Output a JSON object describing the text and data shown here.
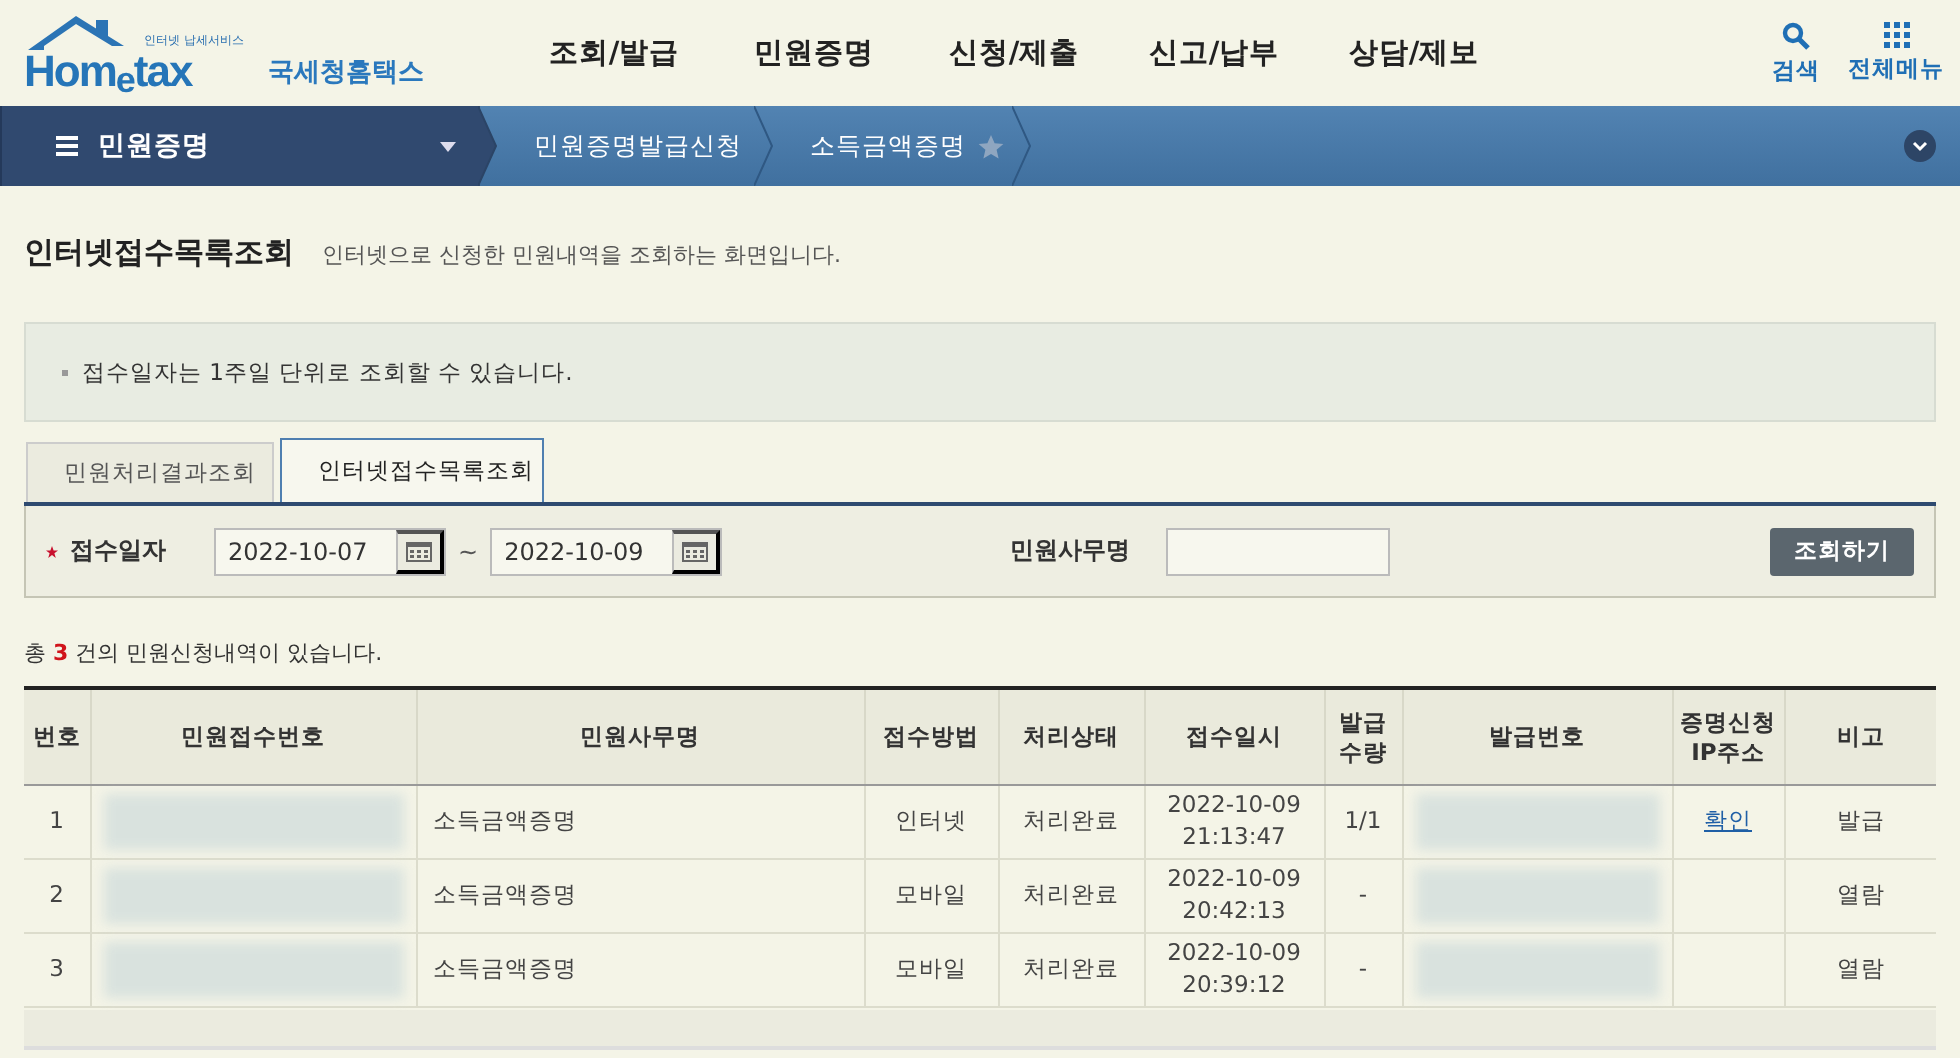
{
  "header": {
    "logo": {
      "tagline": "인터넷 납세서비스",
      "wordmark": "Hom$_{e}$tax",
      "name": "국세청홈택스"
    },
    "menu": [
      "조회/발급",
      "민원증명",
      "신청/제출",
      "신고/납부",
      "상담/제보"
    ],
    "tools": [
      {
        "label": "검색",
        "kind": "search"
      },
      {
        "label": "전체메뉴",
        "kind": "grid"
      }
    ]
  },
  "navbar": {
    "section": "민원증명",
    "breadcrumbs": [
      "민원증명발급신청",
      "소득금액증명"
    ],
    "favorite": false
  },
  "page": {
    "title": "인터넷접수목록조회",
    "description": "인터넷으로 신청한 민원내역을 조회하는 화면입니다.",
    "notices": [
      "접수일자는 1주일 단위로 조회할 수 있습니다."
    ],
    "tabs": [
      {
        "label": "민원처리결과조회",
        "selected": false
      },
      {
        "label": "인터넷접수목록조회",
        "selected": true
      }
    ],
    "search": {
      "date_label": "접수일자",
      "required": true,
      "date_from": "2022-10-07",
      "separator": "~",
      "date_to": "2022-10-09",
      "name_label": "민원사무명",
      "button": "조회하기"
    },
    "count_text": "총 **3** 건의 민원신청내역이 있습니다."
  },
  "table": {
    "columns": [
      "번호",
      "민원접수번호",
      "민원사무명",
      "접수방법",
      "처리상태",
      "접수일시",
      "발급 수량",
      "발급번호",
      "증명신청 IP주소",
      "비고"
    ],
    "rows": [
      {
        "no": "1",
        "receipt_redacted": true,
        "service": "소득금액증명",
        "method": "인터넷",
        "status": "처리완료",
        "received": "2022-10-09 21:13:47",
        "quantity": "1/1",
        "issue_redacted": true,
        "ip_link": "확인",
        "note": "발급"
      },
      {
        "no": "2",
        "receipt_redacted": true,
        "service": "소득금액증명",
        "method": "모바일",
        "status": "처리완료",
        "received": "2022-10-09 20:42:13",
        "quantity": "-",
        "issue_redacted": true,
        "note": "열람"
      },
      {
        "no": "3",
        "receipt_redacted": true,
        "service": "소득금액증명",
        "method": "모바일",
        "status": "처리완료",
        "received": "2022-10-09 20:39:12",
        "quantity": "-",
        "issue_redacted": true,
        "note": "열람"
      }
    ]
  }
}
